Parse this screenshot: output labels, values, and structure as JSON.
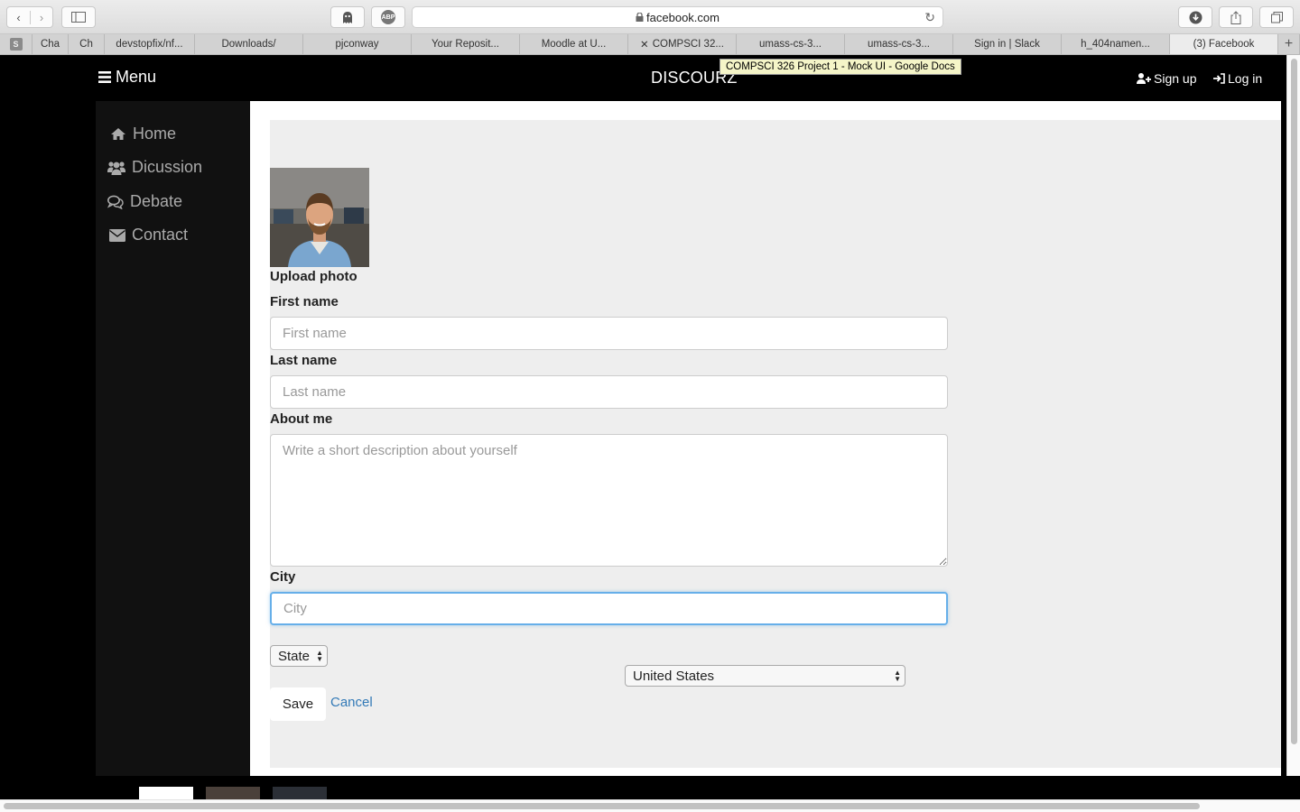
{
  "browser": {
    "url": "facebook.com",
    "tabs": [
      {
        "label": "Cha",
        "active": false
      },
      {
        "label": "Ch",
        "active": false
      },
      {
        "label": "devstopfix/nf...",
        "active": false
      },
      {
        "label": "Downloads/",
        "active": false
      },
      {
        "label": "pjconway",
        "active": false
      },
      {
        "label": "Your Reposit...",
        "active": false
      },
      {
        "label": "Moodle at U...",
        "active": false
      },
      {
        "label": "COMPSCI 32...",
        "active": false
      },
      {
        "label": "umass-cs-3...",
        "active": false
      },
      {
        "label": "umass-cs-3...",
        "active": false
      },
      {
        "label": "Sign in | Slack",
        "active": false
      },
      {
        "label": "h_404namen...",
        "active": false
      },
      {
        "label": "(3) Facebook",
        "active": true
      }
    ],
    "tooltip": "COMPSCI 326 Project 1 - Mock UI - Google Docs",
    "adblock_label": "ABP"
  },
  "nav": {
    "menu_label": "Menu",
    "brand": "DISCOURZ",
    "signup_label": "Sign up",
    "login_label": "Log in"
  },
  "sidebar": {
    "items": [
      {
        "label": "Home",
        "icon": "home-icon"
      },
      {
        "label": "Dicussion",
        "icon": "users-icon"
      },
      {
        "label": "Debate",
        "icon": "comments-icon"
      },
      {
        "label": "Contact",
        "icon": "envelope-icon"
      }
    ]
  },
  "form": {
    "upload_photo_label": "Upload photo",
    "first_name_label": "First name",
    "first_name_placeholder": "First name",
    "last_name_label": "Last name",
    "last_name_placeholder": "Last name",
    "about_label": "About me",
    "about_placeholder": "Write a short description about yourself",
    "city_label": "City",
    "city_placeholder": "City",
    "state_value": "State",
    "country_value": "United States",
    "save_label": "Save",
    "cancel_label": "Cancel"
  },
  "colors": {
    "link": "#337ab7",
    "focus_border": "#66afe9",
    "sidebar_bg": "#111111",
    "panel_bg": "#eeeeee"
  }
}
